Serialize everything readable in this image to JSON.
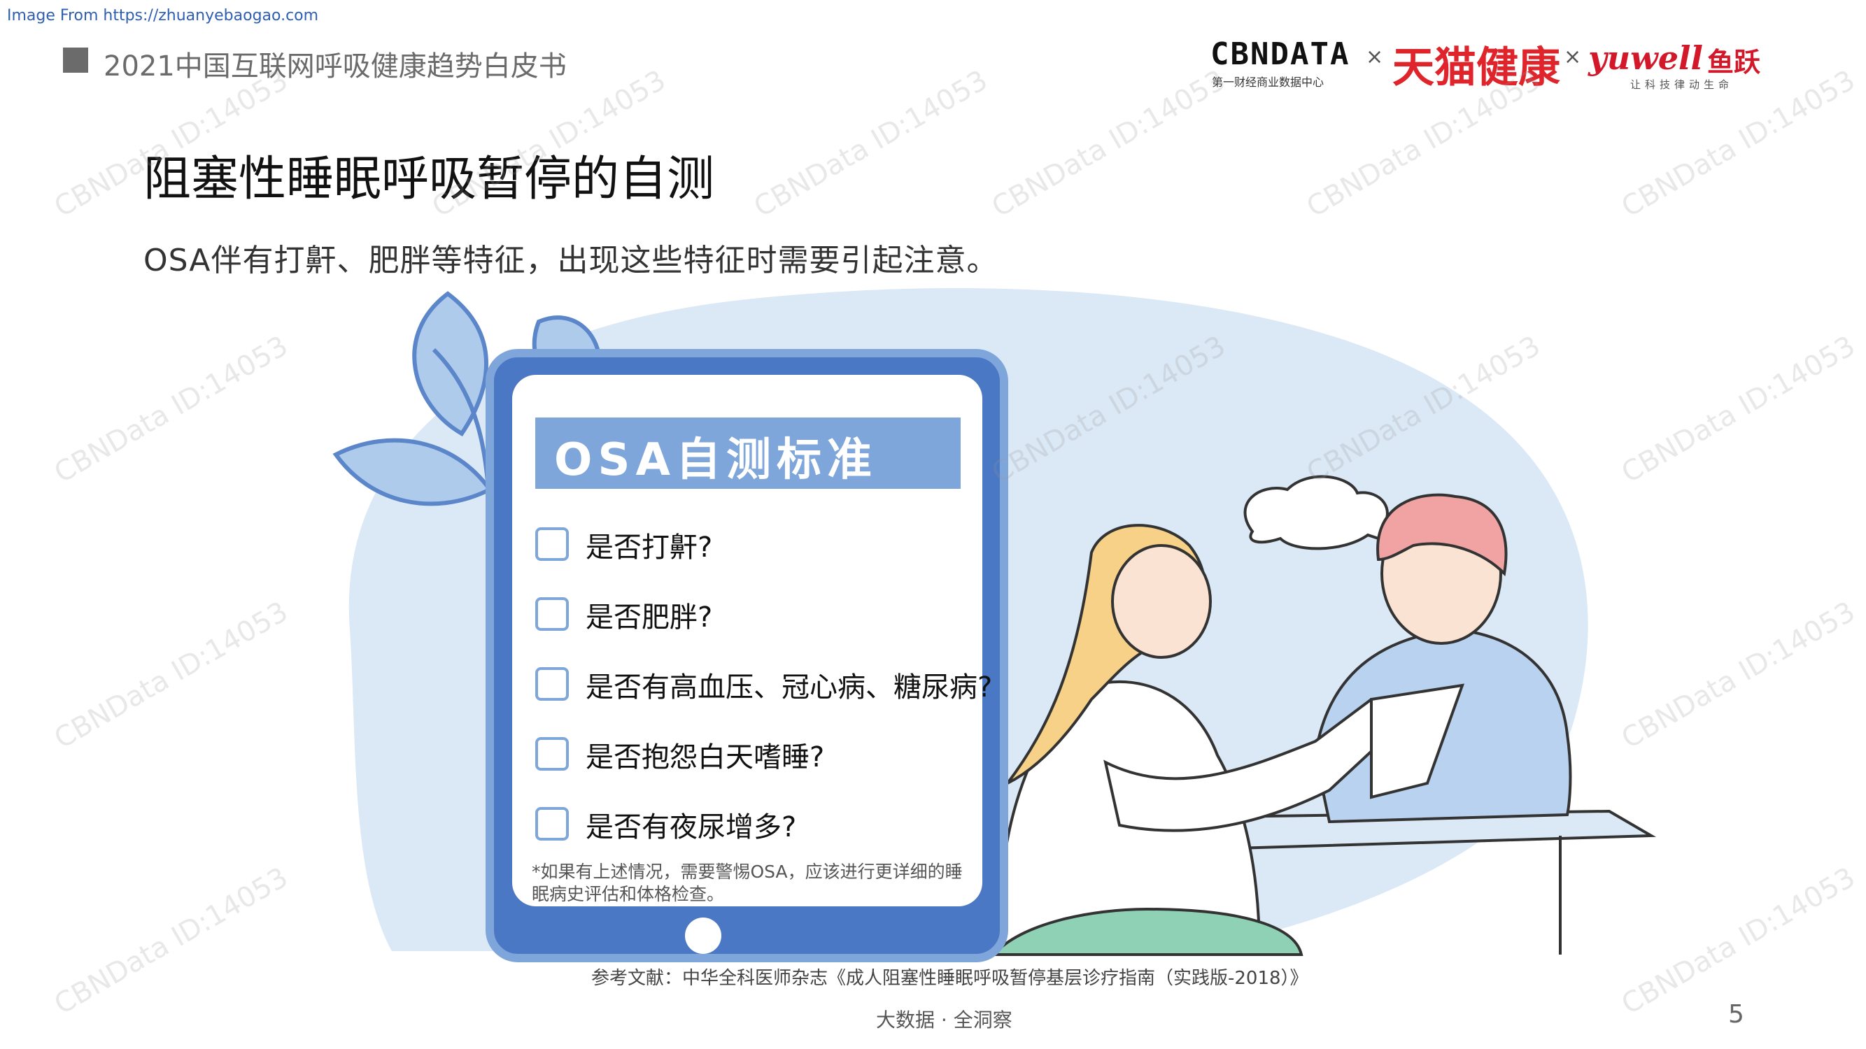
{
  "source_line": "Image From https://zhuanyebaogao.com",
  "header": {
    "report_title": "2021中国互联网呼吸健康趋势白皮书",
    "logos": {
      "cbndata": "CBNDATA",
      "cbndata_sub": "第一财经商业数据中心",
      "tmall_health": "天猫健康",
      "yuwell": "yuwell",
      "yuwell_cn": "鱼跃",
      "yuwell_sub": "让科技律动生命",
      "separator": "×"
    }
  },
  "main_title": "阻塞性睡眠呼吸暂停的自测",
  "subtitle": "OSA伴有打鼾、肥胖等特征，出现这些特征时需要引起注意。",
  "card": {
    "title": "OSA自测标准",
    "items": [
      "是否打鼾?",
      "是否肥胖?",
      "是否有高血压、冠心病、糖尿病?",
      "是否抱怨白天嗜睡?",
      "是否有夜尿增多?"
    ],
    "note": "*如果有上述情况，需要警惕OSA，应该进行更详细的睡眠病史评估和体格检查。"
  },
  "reference": "参考文献：中华全科医师杂志《成人阻塞性睡眠呼吸暂停基层诊疗指南（实践版-2018）》",
  "footer": {
    "slogan": "大数据 · 全洞察",
    "page_number": "5"
  },
  "watermark": "CBNData ID:14053",
  "colors": {
    "card_blue": "#7fa6da",
    "tablet_blue": "#4a78c4",
    "blob_blue": "#dbe8f6",
    "brand_red": "#e0242b"
  }
}
